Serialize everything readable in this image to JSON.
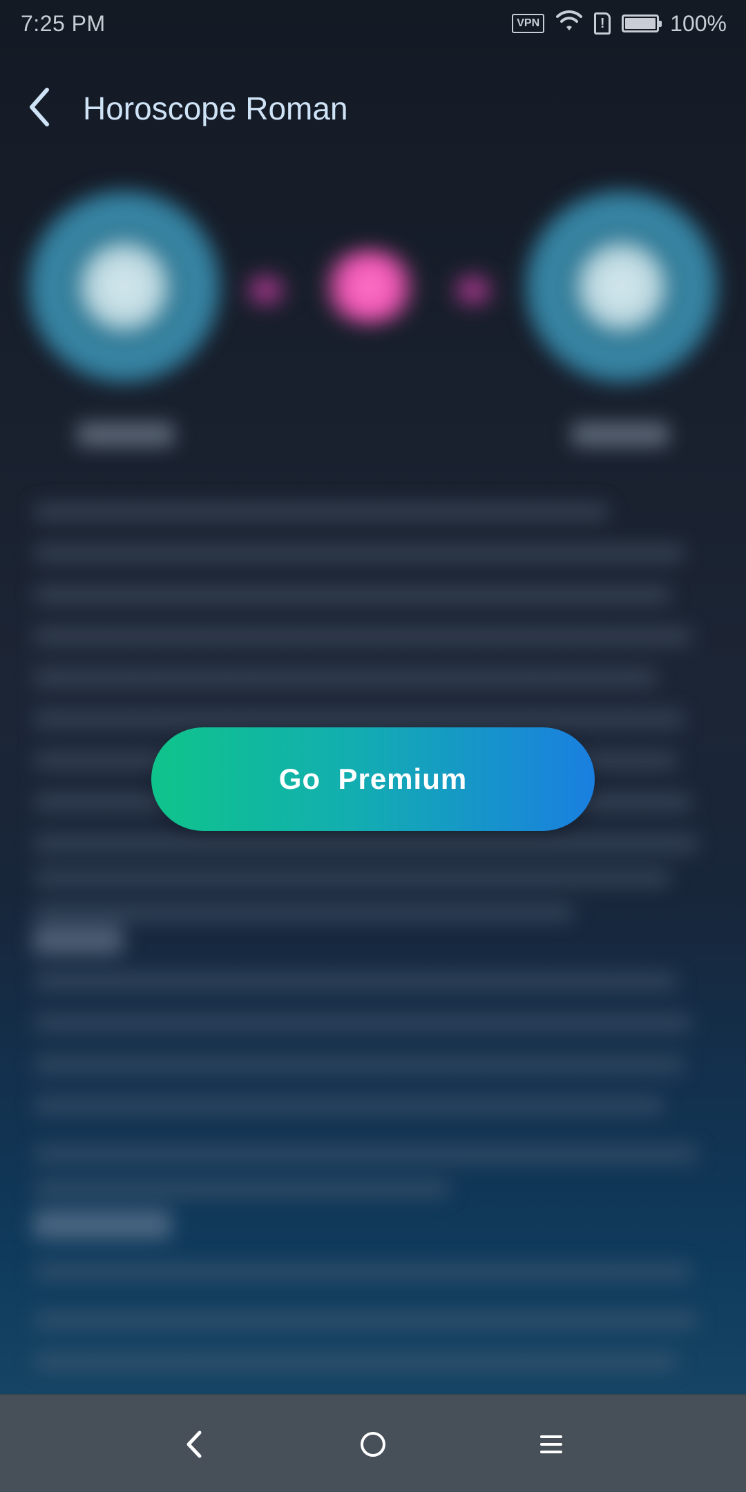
{
  "status_bar": {
    "time": "7:25 PM",
    "vpn_label": "VPN",
    "sim_alert": "!",
    "battery": "100%",
    "icons": [
      "vpn-icon",
      "wifi-icon",
      "sim-alert-icon",
      "battery-icon"
    ]
  },
  "app_bar": {
    "back_icon": "chevron-left-icon",
    "title": "Horoscope Roman"
  },
  "premium": {
    "button_label": "Go  Premium",
    "gradient_start": "#0fc48b",
    "gradient_end": "#1a7fe0"
  },
  "nav_bar": {
    "icons": [
      "back-triangle-icon",
      "home-circle-icon",
      "menu-lines-icon"
    ]
  },
  "colors": {
    "title": "#cfe3f7",
    "accent_heart": "#f054b4",
    "navbar": "#474f58"
  }
}
